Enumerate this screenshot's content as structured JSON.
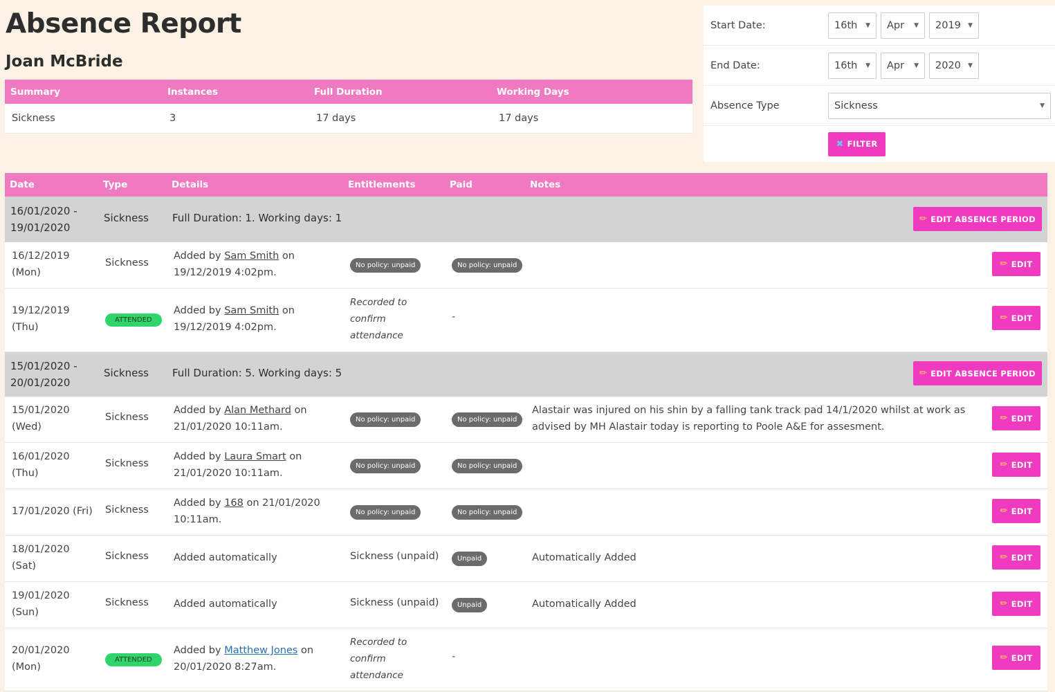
{
  "page": {
    "title": "Absence Report",
    "person": "Joan McBride"
  },
  "summary": {
    "headers": [
      "Summary",
      "Instances",
      "Full Duration",
      "Working Days"
    ],
    "row": {
      "type": "Sickness",
      "instances": "3",
      "full_duration": "17 days",
      "working_days": "17 days"
    }
  },
  "filters": {
    "start_label": "Start Date:",
    "start_day": "16th",
    "start_month": "Apr",
    "start_year": "2019",
    "end_label": "End Date:",
    "end_day": "16th",
    "end_month": "Apr",
    "end_year": "2020",
    "type_label": "Absence Type",
    "type_value": "Sickness",
    "filter_button": "FILTER"
  },
  "table": {
    "headers": [
      "Date",
      "Type",
      "Details",
      "Entitlements",
      "Paid",
      "Notes"
    ],
    "edit_period_label": "EDIT ABSENCE PERIOD",
    "edit_label": "EDIT",
    "groups": [
      {
        "date_line1": "16/01/2020 -",
        "date_line2": "19/01/2020",
        "type": "Sickness",
        "details": "Full Duration: 1. Working days: 1",
        "rows": [
          {
            "date1": "16/12/2019",
            "date2": "(Mon)",
            "type": "Sickness",
            "attended": false,
            "added_prefix": "Added by ",
            "added_by": "Sam Smith",
            "added_suffix": " on",
            "added_line2": "19/12/2019 4:02pm.",
            "ent": "No policy: unpaid",
            "paid": "No policy: unpaid",
            "notes": ""
          },
          {
            "date1": "19/12/2019",
            "date2": "(Thu)",
            "type": "ATTENDED",
            "attended": true,
            "added_prefix": "Added by ",
            "added_by": "Sam Smith",
            "added_suffix": " on",
            "added_line2": "19/12/2019 4:02pm.",
            "ent_l1": "Recorded to",
            "ent_l2": "confirm",
            "ent_l3": "attendance",
            "paid": "-",
            "notes": ""
          }
        ]
      },
      {
        "date_line1": "15/01/2020 -",
        "date_line2": "20/01/2020",
        "type": "Sickness",
        "details": "Full Duration: 5. Working days: 5",
        "rows": [
          {
            "date1": "15/01/2020",
            "date2": "(Wed)",
            "type": "Sickness",
            "added_prefix": "Added by ",
            "added_by": "Alan Methard",
            "added_suffix": " on",
            "added_line2": "21/01/2020 10:11am.",
            "ent": "No policy: unpaid",
            "paid": "No policy: unpaid",
            "notes_l1": "Alastair was injured on his shin by a falling tank track pad 14/1/2020 whilst at work as",
            "notes_l2": "advised by MH Alastair today is reporting to Poole A&E for assesment."
          },
          {
            "date1": "16/01/2020",
            "date2": "(Thu)",
            "type": "Sickness",
            "added_prefix": "Added by ",
            "added_by": "Laura Smart",
            "added_suffix": " on",
            "added_line2": "21/01/2020 10:11am.",
            "ent": "No policy: unpaid",
            "paid": "No policy: unpaid"
          },
          {
            "date1": "17/01/2020 (Fri)",
            "type": "Sickness",
            "added_prefix": "Added by ",
            "added_by": "168",
            "added_suffix": " on 21/01/2020",
            "added_line2": "10:11am.",
            "ent": "No policy: unpaid",
            "paid": "No policy: unpaid"
          },
          {
            "date1": "18/01/2020",
            "date2": "(Sat)",
            "type": "Sickness",
            "details": "Added automatically",
            "ent": "Sickness (unpaid)",
            "paid": "Unpaid",
            "notes": "Automatically Added"
          },
          {
            "date1": "19/01/2020",
            "date2": "(Sun)",
            "type": "Sickness",
            "details": "Added automatically",
            "ent": "Sickness (unpaid)",
            "paid": "Unpaid",
            "notes": "Automatically Added"
          },
          {
            "date1": "20/01/2020",
            "date2": "(Mon)",
            "type": "ATTENDED",
            "added_prefix": "Added by ",
            "added_by": "Matthew Jones",
            "added_suffix": " on",
            "added_line2": "20/01/2020 8:27am.",
            "ent_l1": "Recorded to",
            "ent_l2": "confirm",
            "ent_l3": "attendance",
            "paid": "-"
          }
        ]
      }
    ]
  },
  "colors": {
    "accent": "#f07ac2",
    "button": "#ee3bc0",
    "attended": "#2fd46b",
    "group_bg": "#d3d3d3",
    "page_bg": "#fbf1e4"
  }
}
